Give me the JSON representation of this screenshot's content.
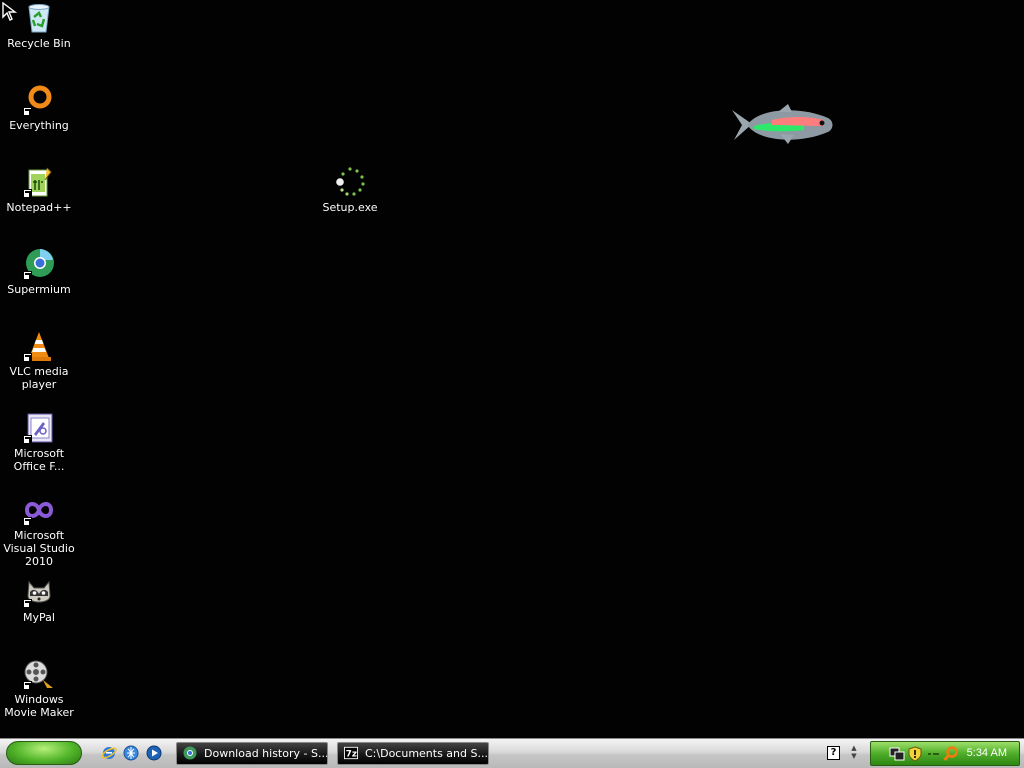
{
  "desktop": {
    "icons": [
      {
        "label": "Recycle Bin",
        "icon": "recycle-bin-icon"
      },
      {
        "label": "Everything",
        "icon": "everything-search-icon"
      },
      {
        "label": "Notepad++",
        "icon": "notepad-plus-plus-icon"
      },
      {
        "label": "Supermium",
        "icon": "supermium-browser-icon"
      },
      {
        "label": "VLC media player",
        "icon": "vlc-cone-icon"
      },
      {
        "label": "Microsoft Office F...",
        "icon": "office-document-icon"
      },
      {
        "label": "Microsoft Visual Studio 2010",
        "icon": "visual-studio-infinity-icon"
      },
      {
        "label": "MyPal",
        "icon": "raccoon-icon"
      },
      {
        "label": "Windows Movie Maker",
        "icon": "film-reel-icon"
      },
      {
        "label": "Setup.exe",
        "icon": "loading-spinner-icon"
      }
    ],
    "wallpaper_object": "fish-icon"
  },
  "taskbar": {
    "quick_launch": [
      "internet-explorer-icon",
      "browser-globe-icon",
      "media-player-icon"
    ],
    "tasks": [
      {
        "label": "Download history - S...",
        "icon": "supermium-browser-icon"
      },
      {
        "label": "C:\\Documents and S...",
        "icon": "7zip-icon"
      }
    ],
    "help_label": "?",
    "tray_icons": [
      "network-icon",
      "security-shield-icon",
      "volume-icon",
      "search-icon"
    ],
    "clock": "5:34 AM"
  },
  "colors": {
    "desktop_background": "#020202",
    "start_button": "#52b52a",
    "tray_background": "#4fae2a"
  }
}
